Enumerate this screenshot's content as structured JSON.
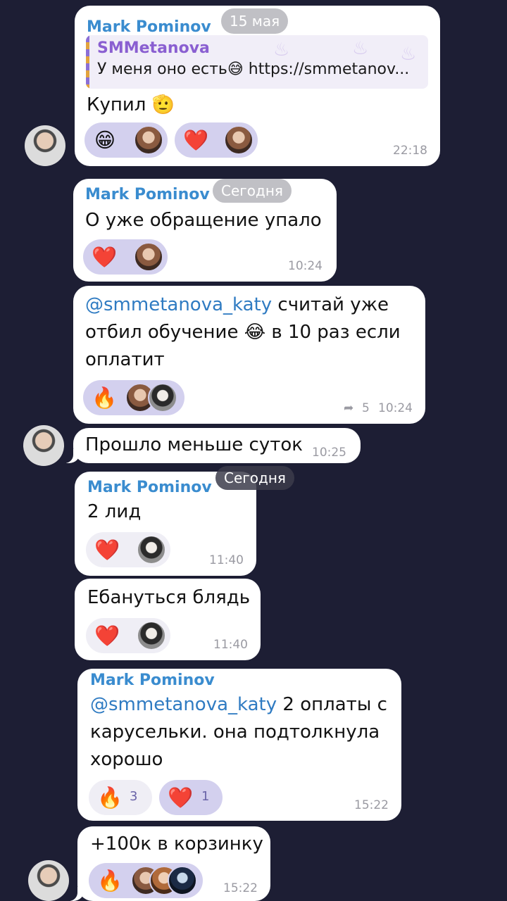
{
  "messages": {
    "m1": {
      "sender": "Mark Pominov",
      "date_chip": "15 мая",
      "quote_author": "SMMetanova",
      "quote_text": "У меня оно есть😅 https://smmetanov...",
      "text": "Купил 🫡",
      "reactions": [
        {
          "emoji": "😁"
        },
        {
          "emoji": "❤️"
        }
      ],
      "time": "22:18"
    },
    "m2": {
      "sender": "Mark Pominov",
      "date_chip": "Сегодня",
      "text": "О уже обращение упало",
      "reactions": [
        {
          "emoji": "❤️"
        }
      ],
      "time": "10:24"
    },
    "m3": {
      "mention": "@smmetanova_katy",
      "text_line1": " считай уже",
      "text_line2": "отбил обучение 😂 в 10 раз если",
      "text_line3": "оплатит",
      "reactions": [
        {
          "emoji": "🔥"
        }
      ],
      "forward_icon": "reply-arrow-icon",
      "forward_count": "5",
      "time": "10:24"
    },
    "m4": {
      "text": "Прошло меньше суток",
      "time": "10:25"
    },
    "m5": {
      "sender": "Mark Pominov",
      "date_chip": "Сегодня",
      "text": "2 лид",
      "reactions": [
        {
          "emoji": "❤️"
        }
      ],
      "time": "11:40"
    },
    "m6": {
      "text": "Ебануться блядь",
      "reactions": [
        {
          "emoji": "❤️"
        }
      ],
      "time": "11:40"
    },
    "m7": {
      "sender": "Mark Pominov",
      "mention": "@smmetanova_katy",
      "text_line1": " 2 оплаты с",
      "text_line2": "карусельки. она подтолкнула",
      "text_line3": "хорошо",
      "reactions": [
        {
          "emoji": "🔥",
          "count": "3"
        },
        {
          "emoji": "❤️",
          "count": "1"
        }
      ],
      "time": "15:22"
    },
    "m8": {
      "text": "+100к в корзинку",
      "reactions": [
        {
          "emoji": "🔥"
        }
      ],
      "time": "15:22"
    }
  },
  "colors": {
    "background": "#1d1e34",
    "bubble": "#ffffff",
    "sender": "#3a8ccf",
    "reaction_active": "#d3d0ee",
    "reaction_inactive": "#efeef5"
  }
}
